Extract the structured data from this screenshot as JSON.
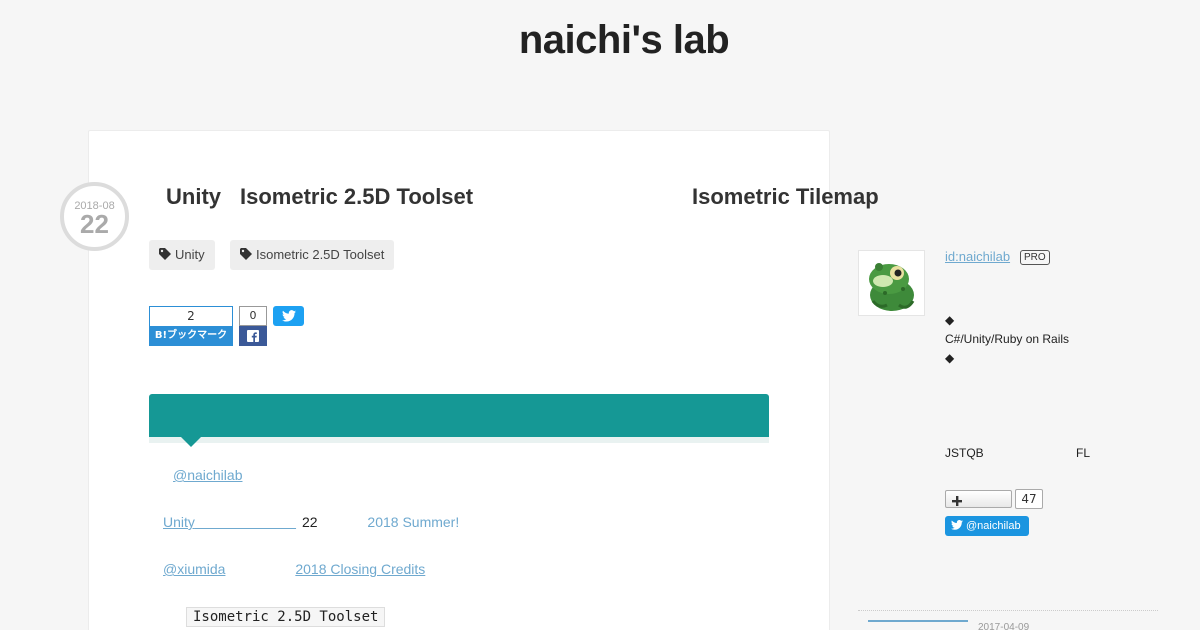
{
  "blog": {
    "title": "naichi's lab"
  },
  "entry": {
    "date_ym": "2018-08",
    "date_day": "22",
    "title_parts": [
      "Unity",
      "Isometric 2.5D Toolset",
      "Isometric Tilemap"
    ],
    "categories": [
      "Unity",
      "Isometric 2.5D Toolset"
    ]
  },
  "social": {
    "hatena_count": "2",
    "hatena_label": "B!ブックマーク",
    "facebook_count": "0"
  },
  "body": {
    "line1_link": "@naichilab",
    "line2_link": "Unity",
    "line2_gap": "                          ",
    "line2_number": "22",
    "line2_event": "2018 Summer!",
    "line3_link": "@xiumida",
    "line3_closing": "2018   Closing Credits",
    "code": "Isometric 2.5D Toolset"
  },
  "sidebar": {
    "profile_id": "id:naichilab",
    "pro_label": "PRO",
    "diamond": "◆",
    "skills": "C#/Unity/Ruby on Rails",
    "cert1": "JSTQB",
    "cert2": "FL",
    "follow_count": "47",
    "twitter_follow": "@naichilab",
    "archive_date": "2017-04-09"
  },
  "colors": {
    "accent_teal": "#159895",
    "link": "#6fa9cf",
    "hatena_blue": "#2c8fd6",
    "facebook_blue": "#3b5998",
    "twitter_blue": "#1da1f2"
  }
}
